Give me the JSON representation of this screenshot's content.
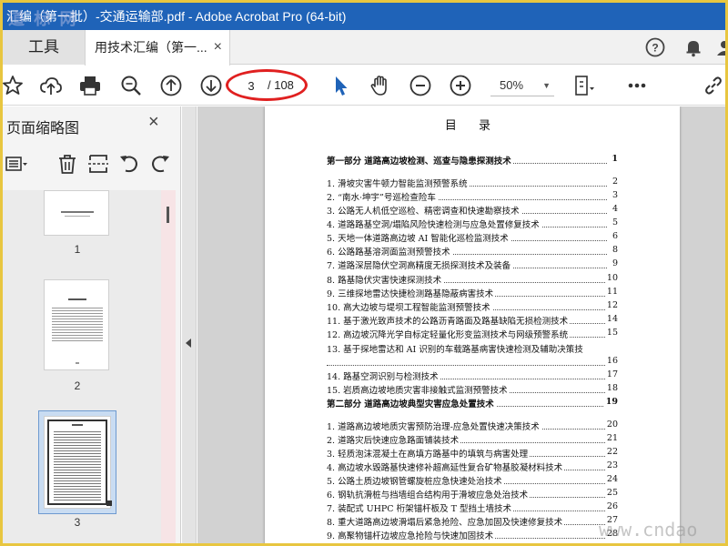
{
  "window": {
    "title": "汇编（第一批）-交通运输部.pdf - Adobe Acrobat Pro (64-bit)",
    "watermark_top": "道 标 网",
    "watermark_bottom": "www.cndao"
  },
  "tabs": {
    "tools_label": "工具",
    "doc_label": "用技术汇编（第一...",
    "doc_close": "×"
  },
  "toolbar": {
    "page_current": "3",
    "page_total": "/ 108",
    "zoom_value": "50%",
    "zoom_caret": "▼"
  },
  "sidebar": {
    "title": "页面缩略图",
    "close": "×",
    "thumbnails": [
      {
        "label": "1"
      },
      {
        "label": "2"
      },
      {
        "label": "3"
      }
    ]
  },
  "document": {
    "toc_title": "目 录",
    "entries": [
      {
        "text": "第一部分  道路高边坡检测、巡查与隐患探测技术",
        "page": "1",
        "bold": true
      },
      {
        "text": "1. 滑坡灾害牛顿力智能监测预警系统",
        "page": "2"
      },
      {
        "text": "2. “南水·坤宇”号巡检查险车",
        "page": "3"
      },
      {
        "text": "3. 公路无人机低空巡检、精密调查和快速勘察技术",
        "page": "4"
      },
      {
        "text": "4. 道路路基空洞/塌陷风险快速检测与应急处置修复技术",
        "page": "5"
      },
      {
        "text": "5. 天地一体道路高边坡 AI 智能化巡检监测技术",
        "page": "6"
      },
      {
        "text": "6. 公路路基溶洞面监测预警技术",
        "page": "8"
      },
      {
        "text": "7. 道路深层隐伏空洞高精度无损探测技术及装备",
        "page": "9"
      },
      {
        "text": "8. 路基隐伏灾害快速探测技术",
        "page": "10"
      },
      {
        "text": "9. 三维探地雷达快捷检测路基隐蔽病害技术",
        "page": "11"
      },
      {
        "text": "10. 高大边坡与堤坝工程智能监测预警技术",
        "page": "12"
      },
      {
        "text": "11. 基于激光致声技术的公路沥青路面及路基缺陷无损检测技术",
        "page": "14"
      },
      {
        "text": "12. 高边坡沉降光学自标定轻量化形变监测技术与网级预警系统",
        "page": "15"
      },
      {
        "text": "13. 基于探地雷达和 AI 识别的车载路基病害快速检测及辅助决策技",
        "page": ""
      },
      {
        "text": "",
        "page": "16"
      },
      {
        "text": "14. 路基空洞识别与检测技术",
        "page": "17"
      },
      {
        "text": "15. 岩质高边坡地质灾害非接触式监测预警技术",
        "page": "18"
      },
      {
        "text": "第二部分  道路高边坡典型灾害应急处置技术",
        "page": "19",
        "bold": true
      },
      {
        "text": "1. 道路高边坡地质灾害预防治理-应急处置快速决策技术",
        "page": "20"
      },
      {
        "text": "2. 道路灾后快速应急路面铺装技术",
        "page": "21"
      },
      {
        "text": "3. 轻质泡沫混凝土在高填方路基中的填筑与病害处理",
        "page": "22"
      },
      {
        "text": "4. 高边坡水毁路基快速修补超高延性复合矿物基胶凝材料技术",
        "page": "23"
      },
      {
        "text": "5. 公路土质边坡钢管螺旋桩应急快速处治技术",
        "page": "24"
      },
      {
        "text": "6. 钢轨抗滑桩与挡墙组合结构用于滑坡应急处治技术",
        "page": "25"
      },
      {
        "text": "7. 装配式 UHPC 桁架锚杆板及 T 型挡土墙技术",
        "page": "26"
      },
      {
        "text": "8. 重大道路高边坡滑塌后紧急抢险、应急加固及快速修复技术",
        "page": "27"
      },
      {
        "text": "9. 高聚物锚杆边坡应急抢险与快速加固技术",
        "page": "28"
      }
    ]
  }
}
